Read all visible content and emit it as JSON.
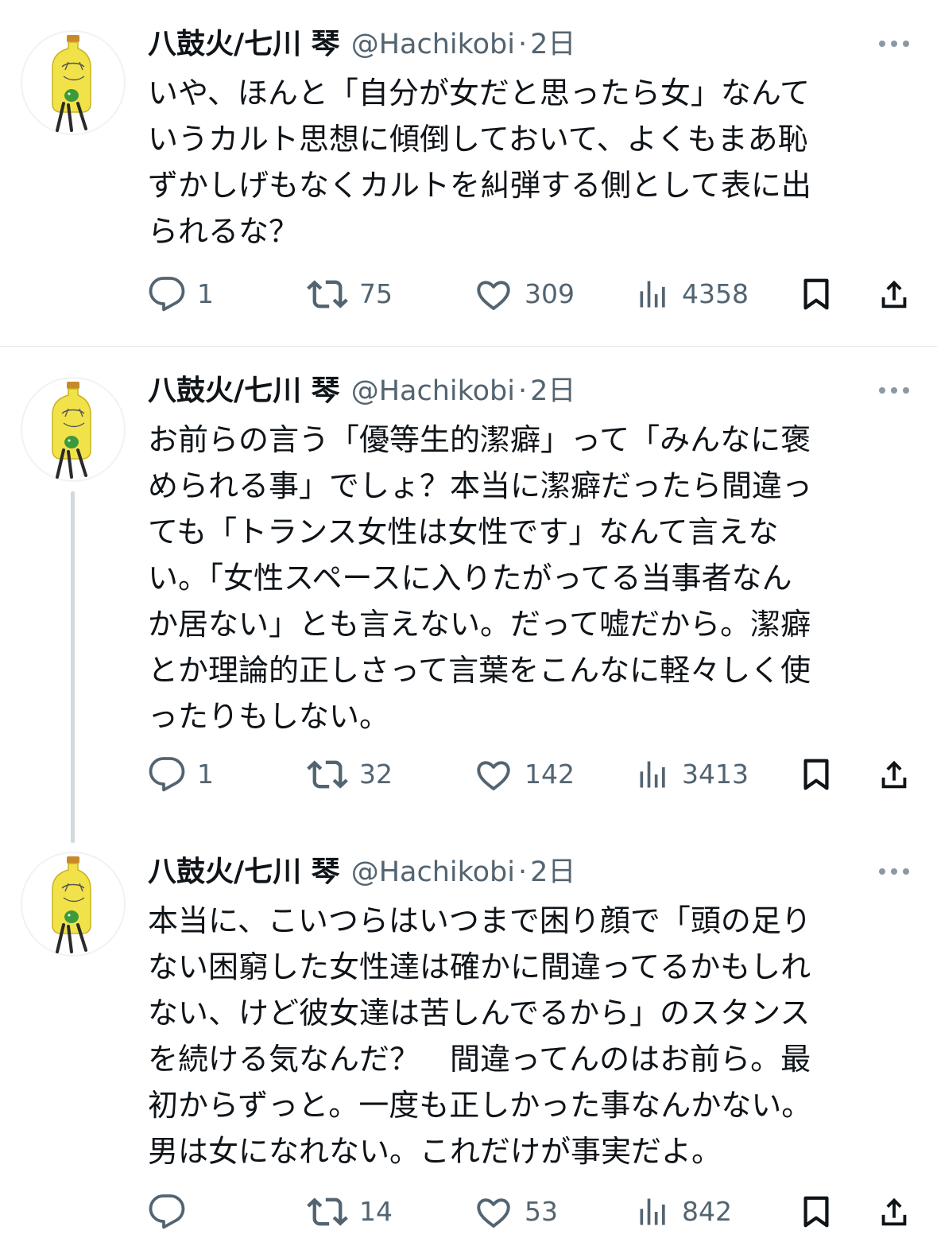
{
  "tweets": [
    {
      "author_name": "八鼓火/七川 琴",
      "handle": "@Hachikobi",
      "separator": "·",
      "time": "2日",
      "text": "いや、ほんと「自分が女だと思ったら女」なんて\nいうカルト思想に傾倒しておいて、よくもまあ恥\nずかしげもなくカルトを糾弾する側として表に出\nられるな？",
      "replies": "1",
      "reposts": "75",
      "likes": "309",
      "views": "4358"
    },
    {
      "author_name": "八鼓火/七川 琴",
      "handle": "@Hachikobi",
      "separator": "·",
      "time": "2日",
      "text": "お前らの言う「優等生的潔癖」って「みんなに褒\nめられる事」でしょ？本当に潔癖だったら間違っ\nても「トランス女性は女性です」なんて言えな\nい。「女性スペースに入りたがってる当事者なん\nか居ない」とも言えない。だって嘘だから。潔癖\nとか理論的正しさって言葉をこんなに軽々しく使\nったりもしない。",
      "replies": "1",
      "reposts": "32",
      "likes": "142",
      "views": "3413"
    },
    {
      "author_name": "八鼓火/七川 琴",
      "handle": "@Hachikobi",
      "separator": "·",
      "time": "2日",
      "text": "本当に、こいつらはいつまで困り顔で「頭の足り\nない困窮した女性達は確かに間違ってるかもしれ\nない、けど彼女達は苦しんでるから」のスタンス\nを続ける気なんだ？　間違ってんのはお前ら。最\n初からずっと。一度も正しかった事なんかない。\n男は女になれない。これだけが事実だよ。",
      "replies": "",
      "reposts": "14",
      "likes": "53",
      "views": "842"
    }
  ],
  "icons": {
    "more": "more-horizontal-icon",
    "reply": "reply-bubble-icon",
    "repost": "repost-arrows-icon",
    "like": "heart-icon",
    "views": "views-bar-chart-icon",
    "bookmark": "bookmark-icon",
    "share": "share-upload-icon"
  },
  "colors": {
    "text": "#0f1419",
    "secondary": "#536471",
    "thread_line": "#cfd9de",
    "divider": "#e1e6ea"
  }
}
